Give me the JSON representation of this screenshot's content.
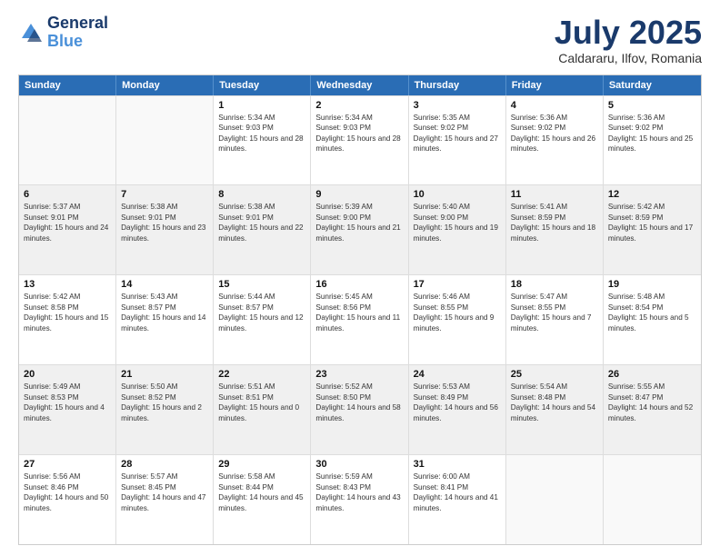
{
  "header": {
    "logo_general": "General",
    "logo_blue": "Blue",
    "month": "July 2025",
    "location": "Caldararu, Ilfov, Romania"
  },
  "days_of_week": [
    "Sunday",
    "Monday",
    "Tuesday",
    "Wednesday",
    "Thursday",
    "Friday",
    "Saturday"
  ],
  "weeks": [
    [
      {
        "day": "",
        "sunrise": "",
        "sunset": "",
        "daylight": ""
      },
      {
        "day": "",
        "sunrise": "",
        "sunset": "",
        "daylight": ""
      },
      {
        "day": "1",
        "sunrise": "Sunrise: 5:34 AM",
        "sunset": "Sunset: 9:03 PM",
        "daylight": "Daylight: 15 hours and 28 minutes."
      },
      {
        "day": "2",
        "sunrise": "Sunrise: 5:34 AM",
        "sunset": "Sunset: 9:03 PM",
        "daylight": "Daylight: 15 hours and 28 minutes."
      },
      {
        "day": "3",
        "sunrise": "Sunrise: 5:35 AM",
        "sunset": "Sunset: 9:02 PM",
        "daylight": "Daylight: 15 hours and 27 minutes."
      },
      {
        "day": "4",
        "sunrise": "Sunrise: 5:36 AM",
        "sunset": "Sunset: 9:02 PM",
        "daylight": "Daylight: 15 hours and 26 minutes."
      },
      {
        "day": "5",
        "sunrise": "Sunrise: 5:36 AM",
        "sunset": "Sunset: 9:02 PM",
        "daylight": "Daylight: 15 hours and 25 minutes."
      }
    ],
    [
      {
        "day": "6",
        "sunrise": "Sunrise: 5:37 AM",
        "sunset": "Sunset: 9:01 PM",
        "daylight": "Daylight: 15 hours and 24 minutes."
      },
      {
        "day": "7",
        "sunrise": "Sunrise: 5:38 AM",
        "sunset": "Sunset: 9:01 PM",
        "daylight": "Daylight: 15 hours and 23 minutes."
      },
      {
        "day": "8",
        "sunrise": "Sunrise: 5:38 AM",
        "sunset": "Sunset: 9:01 PM",
        "daylight": "Daylight: 15 hours and 22 minutes."
      },
      {
        "day": "9",
        "sunrise": "Sunrise: 5:39 AM",
        "sunset": "Sunset: 9:00 PM",
        "daylight": "Daylight: 15 hours and 21 minutes."
      },
      {
        "day": "10",
        "sunrise": "Sunrise: 5:40 AM",
        "sunset": "Sunset: 9:00 PM",
        "daylight": "Daylight: 15 hours and 19 minutes."
      },
      {
        "day": "11",
        "sunrise": "Sunrise: 5:41 AM",
        "sunset": "Sunset: 8:59 PM",
        "daylight": "Daylight: 15 hours and 18 minutes."
      },
      {
        "day": "12",
        "sunrise": "Sunrise: 5:42 AM",
        "sunset": "Sunset: 8:59 PM",
        "daylight": "Daylight: 15 hours and 17 minutes."
      }
    ],
    [
      {
        "day": "13",
        "sunrise": "Sunrise: 5:42 AM",
        "sunset": "Sunset: 8:58 PM",
        "daylight": "Daylight: 15 hours and 15 minutes."
      },
      {
        "day": "14",
        "sunrise": "Sunrise: 5:43 AM",
        "sunset": "Sunset: 8:57 PM",
        "daylight": "Daylight: 15 hours and 14 minutes."
      },
      {
        "day": "15",
        "sunrise": "Sunrise: 5:44 AM",
        "sunset": "Sunset: 8:57 PM",
        "daylight": "Daylight: 15 hours and 12 minutes."
      },
      {
        "day": "16",
        "sunrise": "Sunrise: 5:45 AM",
        "sunset": "Sunset: 8:56 PM",
        "daylight": "Daylight: 15 hours and 11 minutes."
      },
      {
        "day": "17",
        "sunrise": "Sunrise: 5:46 AM",
        "sunset": "Sunset: 8:55 PM",
        "daylight": "Daylight: 15 hours and 9 minutes."
      },
      {
        "day": "18",
        "sunrise": "Sunrise: 5:47 AM",
        "sunset": "Sunset: 8:55 PM",
        "daylight": "Daylight: 15 hours and 7 minutes."
      },
      {
        "day": "19",
        "sunrise": "Sunrise: 5:48 AM",
        "sunset": "Sunset: 8:54 PM",
        "daylight": "Daylight: 15 hours and 5 minutes."
      }
    ],
    [
      {
        "day": "20",
        "sunrise": "Sunrise: 5:49 AM",
        "sunset": "Sunset: 8:53 PM",
        "daylight": "Daylight: 15 hours and 4 minutes."
      },
      {
        "day": "21",
        "sunrise": "Sunrise: 5:50 AM",
        "sunset": "Sunset: 8:52 PM",
        "daylight": "Daylight: 15 hours and 2 minutes."
      },
      {
        "day": "22",
        "sunrise": "Sunrise: 5:51 AM",
        "sunset": "Sunset: 8:51 PM",
        "daylight": "Daylight: 15 hours and 0 minutes."
      },
      {
        "day": "23",
        "sunrise": "Sunrise: 5:52 AM",
        "sunset": "Sunset: 8:50 PM",
        "daylight": "Daylight: 14 hours and 58 minutes."
      },
      {
        "day": "24",
        "sunrise": "Sunrise: 5:53 AM",
        "sunset": "Sunset: 8:49 PM",
        "daylight": "Daylight: 14 hours and 56 minutes."
      },
      {
        "day": "25",
        "sunrise": "Sunrise: 5:54 AM",
        "sunset": "Sunset: 8:48 PM",
        "daylight": "Daylight: 14 hours and 54 minutes."
      },
      {
        "day": "26",
        "sunrise": "Sunrise: 5:55 AM",
        "sunset": "Sunset: 8:47 PM",
        "daylight": "Daylight: 14 hours and 52 minutes."
      }
    ],
    [
      {
        "day": "27",
        "sunrise": "Sunrise: 5:56 AM",
        "sunset": "Sunset: 8:46 PM",
        "daylight": "Daylight: 14 hours and 50 minutes."
      },
      {
        "day": "28",
        "sunrise": "Sunrise: 5:57 AM",
        "sunset": "Sunset: 8:45 PM",
        "daylight": "Daylight: 14 hours and 47 minutes."
      },
      {
        "day": "29",
        "sunrise": "Sunrise: 5:58 AM",
        "sunset": "Sunset: 8:44 PM",
        "daylight": "Daylight: 14 hours and 45 minutes."
      },
      {
        "day": "30",
        "sunrise": "Sunrise: 5:59 AM",
        "sunset": "Sunset: 8:43 PM",
        "daylight": "Daylight: 14 hours and 43 minutes."
      },
      {
        "day": "31",
        "sunrise": "Sunrise: 6:00 AM",
        "sunset": "Sunset: 8:41 PM",
        "daylight": "Daylight: 14 hours and 41 minutes."
      },
      {
        "day": "",
        "sunrise": "",
        "sunset": "",
        "daylight": ""
      },
      {
        "day": "",
        "sunrise": "",
        "sunset": "",
        "daylight": ""
      }
    ]
  ]
}
